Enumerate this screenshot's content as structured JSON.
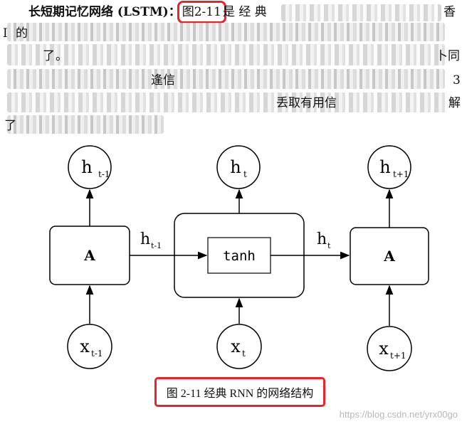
{
  "document": {
    "term_label": "长短期记忆网络 (LSTM)：",
    "figure_ref": "图2-11",
    "para_continuation": "是 经 典",
    "line1_end": "香",
    "line2_start": "I",
    "line2_after": "的",
    "line3_start": "了",
    "line3_mid": "。",
    "line3_end": "卜同",
    "line4_mid": "逢信",
    "line4_end": "3",
    "line5_mid": "丢取有用信",
    "line5_end": "解",
    "line6_start": "了"
  },
  "diagram": {
    "top_nodes": [
      {
        "main": "h",
        "sub": "t-1"
      },
      {
        "main": "h",
        "sub": "t"
      },
      {
        "main": "h",
        "sub": "t+1"
      }
    ],
    "bottom_nodes": [
      {
        "main": "x",
        "sub": "t-1"
      },
      {
        "main": "x",
        "sub": "t"
      },
      {
        "main": "x",
        "sub": "t+1"
      }
    ],
    "cells": [
      {
        "label": "A"
      },
      {
        "label": "tanh"
      },
      {
        "label": "A"
      }
    ],
    "connections": [
      {
        "main": "h",
        "sub": "t-1"
      },
      {
        "main": "h",
        "sub": "t"
      }
    ]
  },
  "caption": "图 2-11 经典 RNN 的网络结构",
  "watermark": "https://blog.csdn.net/yrx00go"
}
